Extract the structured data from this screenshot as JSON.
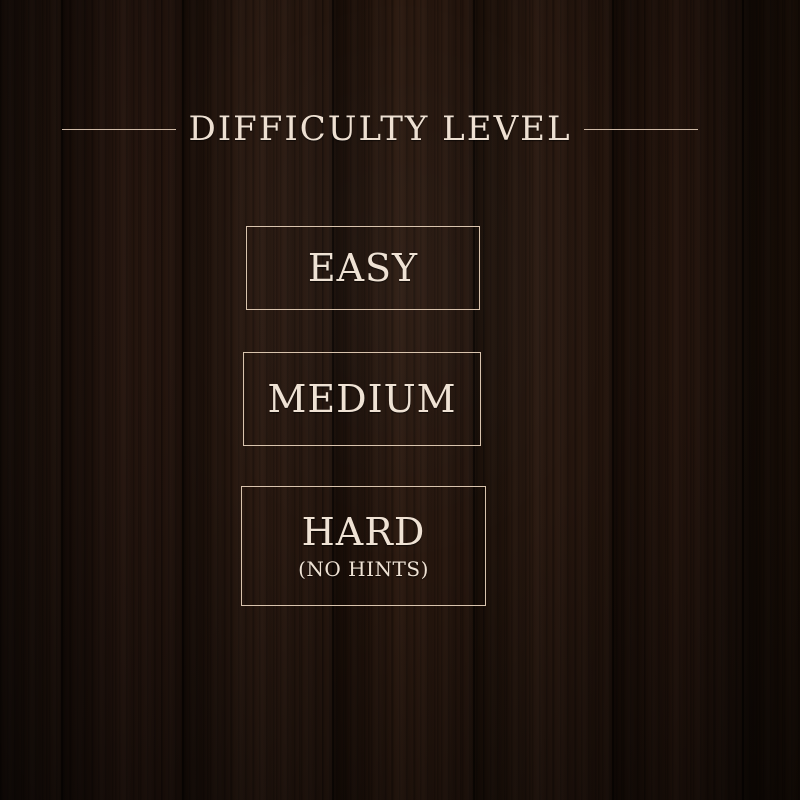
{
  "screen": {
    "title": "DIFFICULTY LEVEL"
  },
  "options": [
    {
      "label": "EASY",
      "sublabel": ""
    },
    {
      "label": "MEDIUM",
      "sublabel": ""
    },
    {
      "label": "HARD",
      "sublabel": "(NO HINTS)"
    }
  ],
  "colors": {
    "text": "#efe2d4",
    "border": "#d8c3ad",
    "background": "#24150d"
  }
}
